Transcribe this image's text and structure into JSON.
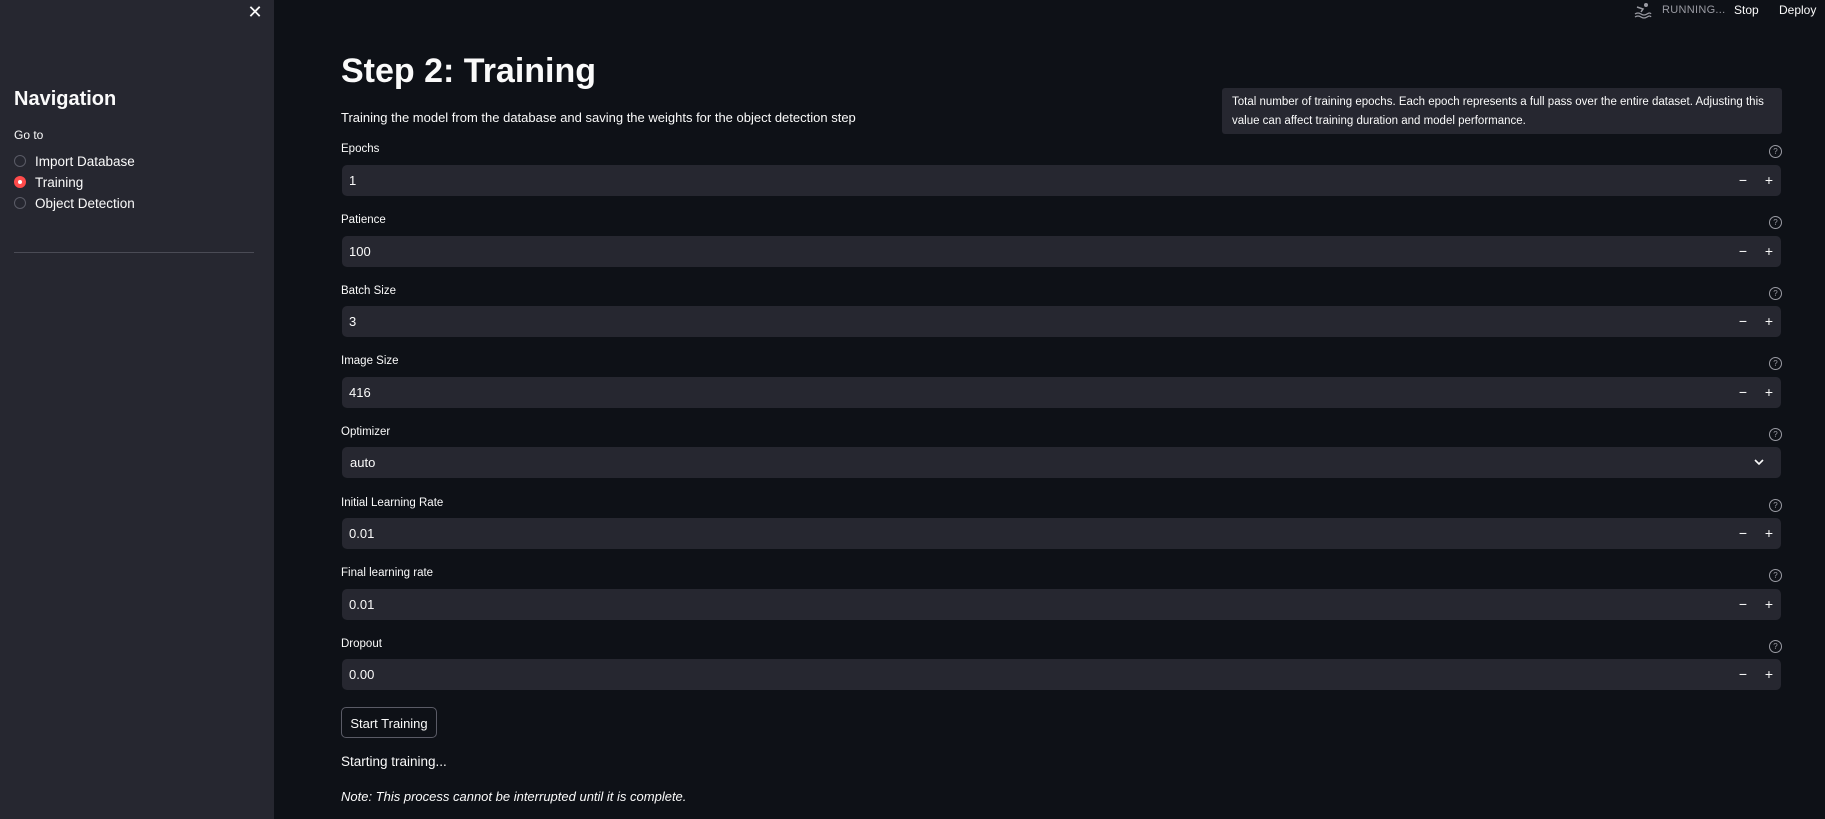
{
  "sidebar": {
    "close_icon": "close-icon",
    "title": "Navigation",
    "goto_label": "Go to",
    "items": [
      {
        "label": "Import Database",
        "selected": false
      },
      {
        "label": "Training",
        "selected": true
      },
      {
        "label": "Object Detection",
        "selected": false
      }
    ]
  },
  "topbar": {
    "status_icon": "running-swimmer-icon",
    "status": "RUNNING...",
    "stop": "Stop",
    "deploy": "Deploy"
  },
  "main": {
    "title": "Step 2: Training",
    "subtitle": "Training the model from the database and saving the weights for the object detection step",
    "tooltip": "Total number of training epochs. Each epoch represents a full pass over the entire dataset. Adjusting this value can affect training duration and model performance.",
    "fields": [
      {
        "label": "Epochs",
        "value": "1"
      },
      {
        "label": "Patience",
        "value": "100"
      },
      {
        "label": "Batch Size",
        "value": "3"
      },
      {
        "label": "Image Size",
        "value": "416"
      },
      {
        "label": "Optimizer",
        "value": "auto"
      },
      {
        "label": "Initial Learning Rate",
        "value": "0.01"
      },
      {
        "label": "Final learning rate",
        "value": "0.01"
      },
      {
        "label": "Dropout",
        "value": "0.00"
      }
    ],
    "stepper_minus": "−",
    "stepper_plus": "+",
    "help_glyph": "?",
    "start_button": "Start Training",
    "status_text": "Starting training...",
    "note": "Note: This process cannot be interrupted until it is complete."
  },
  "colors": {
    "background": "#0e1117",
    "sidebar": "#262730",
    "accent": "#ff4b4b"
  }
}
